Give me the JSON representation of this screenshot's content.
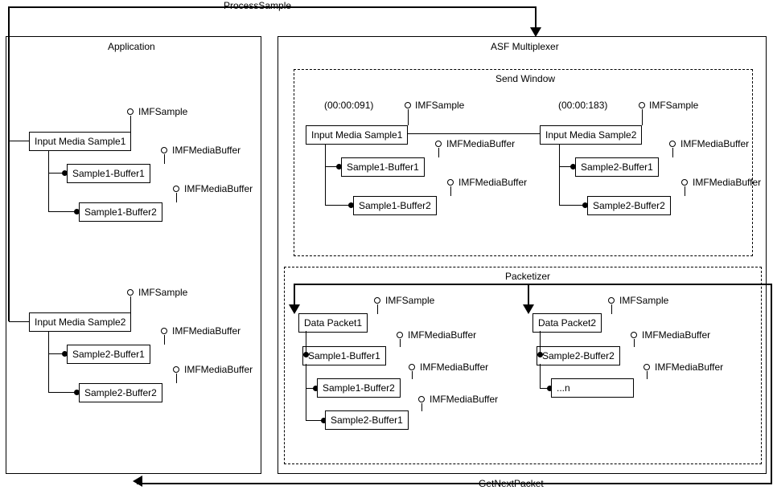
{
  "flows": {
    "processSample": "ProcessSample",
    "getNextPacket": "GetNextPacket"
  },
  "application": {
    "title": "Application",
    "ifSample": "IMFSample",
    "ifBuffer": "IMFMediaBuffer",
    "sample1": {
      "title": "Input Media Sample1",
      "buf1": "Sample1-Buffer1",
      "buf2": "Sample1-Buffer2"
    },
    "sample2": {
      "title": "Input Media Sample2",
      "buf1": "Sample2-Buffer1",
      "buf2": "Sample2-Buffer2"
    }
  },
  "multiplexer": {
    "title": "ASF Multiplexer",
    "sendWindow": {
      "title": "Send Window",
      "ifSample": "IMFSample",
      "ifBuffer": "IMFMediaBuffer",
      "sample1": {
        "time": "(00:00:091)",
        "title": "Input Media Sample1",
        "buf1": "Sample1-Buffer1",
        "buf2": "Sample1-Buffer2"
      },
      "sample2": {
        "time": "(00:00:183)",
        "title": "Input Media Sample2",
        "buf1": "Sample2-Buffer1",
        "buf2": "Sample2-Buffer2"
      }
    },
    "packetizer": {
      "title": "Packetizer",
      "ifSample": "IMFSample",
      "ifBuffer": "IMFMediaBuffer",
      "packet1": {
        "title": "Data Packet1",
        "buf1": "Sample1-Buffer1",
        "buf2": "Sample1-Buffer2",
        "buf3": "Sample2-Buffer1"
      },
      "packet2": {
        "title": "Data Packet2",
        "buf1": "Sample2-Buffer2",
        "buf2": "...n"
      }
    }
  }
}
